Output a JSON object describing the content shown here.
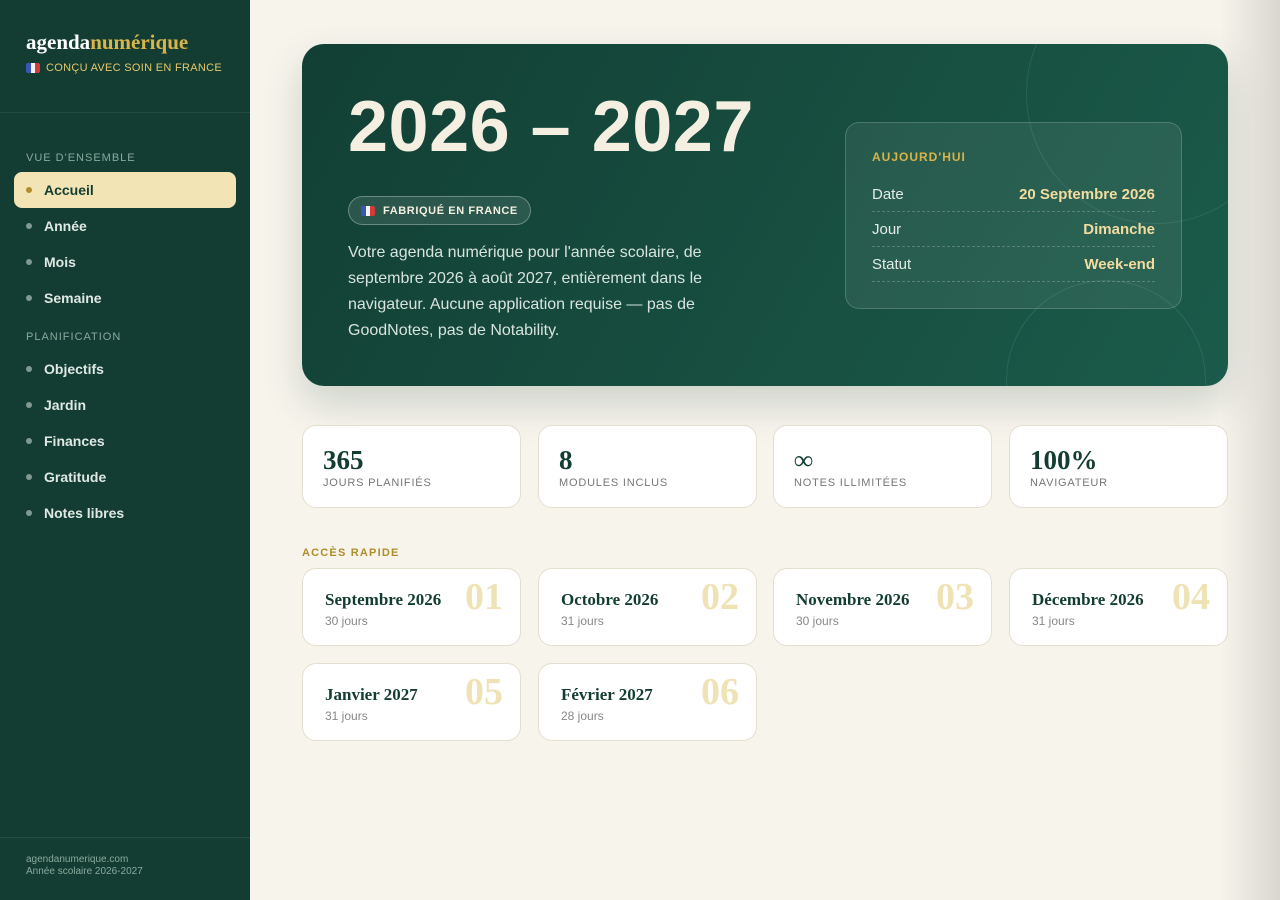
{
  "brand": {
    "part1": "agenda",
    "part2": "numérique",
    "tagline": "CONÇU AVEC SOIN EN FRANCE"
  },
  "sidebar": {
    "section1": "VUE D'ENSEMBLE",
    "section2": "PLANIFICATION",
    "items": [
      {
        "label": "Accueil",
        "active": true
      },
      {
        "label": "Année"
      },
      {
        "label": "Mois"
      },
      {
        "label": "Semaine"
      },
      {
        "label": "Objectifs"
      },
      {
        "label": "Jardin"
      },
      {
        "label": "Finances"
      },
      {
        "label": "Gratitude"
      },
      {
        "label": "Notes libres"
      }
    ],
    "footer": {
      "site": "agendanumerique.com",
      "year": "Année scolaire 2026-2027"
    }
  },
  "hero": {
    "title": "2026 – 2027",
    "badge": "FABRIQUÉ EN FRANCE",
    "description": "Votre agenda numérique pour l'année scolaire, de septembre 2026 à août 2027, entièrement dans le navigateur. Aucune application requise — pas de GoodNotes, pas de Notability.",
    "today": {
      "title": "AUJOURD'HUI",
      "rows": [
        {
          "key": "Date",
          "value": "20 Septembre 2026"
        },
        {
          "key": "Jour",
          "value": "Dimanche"
        },
        {
          "key": "Statut",
          "value": "Week-end"
        }
      ]
    }
  },
  "stats": [
    {
      "value": "365",
      "label": "JOURS PLANIFIÉS"
    },
    {
      "value": "8",
      "label": "MODULES INCLUS"
    },
    {
      "value": "∞",
      "label": "NOTES ILLIMITÉES"
    },
    {
      "value": "100%",
      "label": "NAVIGATEUR"
    }
  ],
  "quick_access": {
    "title": "ACCÈS RAPIDE",
    "months": [
      {
        "name": "Septembre 2026",
        "days": "30 jours",
        "num": "01"
      },
      {
        "name": "Octobre 2026",
        "days": "31 jours",
        "num": "02"
      },
      {
        "name": "Novembre 2026",
        "days": "30 jours",
        "num": "03"
      },
      {
        "name": "Décembre 2026",
        "days": "31 jours",
        "num": "04"
      },
      {
        "name": "Janvier 2027",
        "days": "31 jours",
        "num": "05"
      },
      {
        "name": "Février 2027",
        "days": "28 jours",
        "num": "06"
      }
    ]
  },
  "colors": {
    "sidebar": "#133d32",
    "accent": "#d9b44a",
    "active_bg": "#f2e4b5",
    "page_bg": "#f7f4ec"
  }
}
